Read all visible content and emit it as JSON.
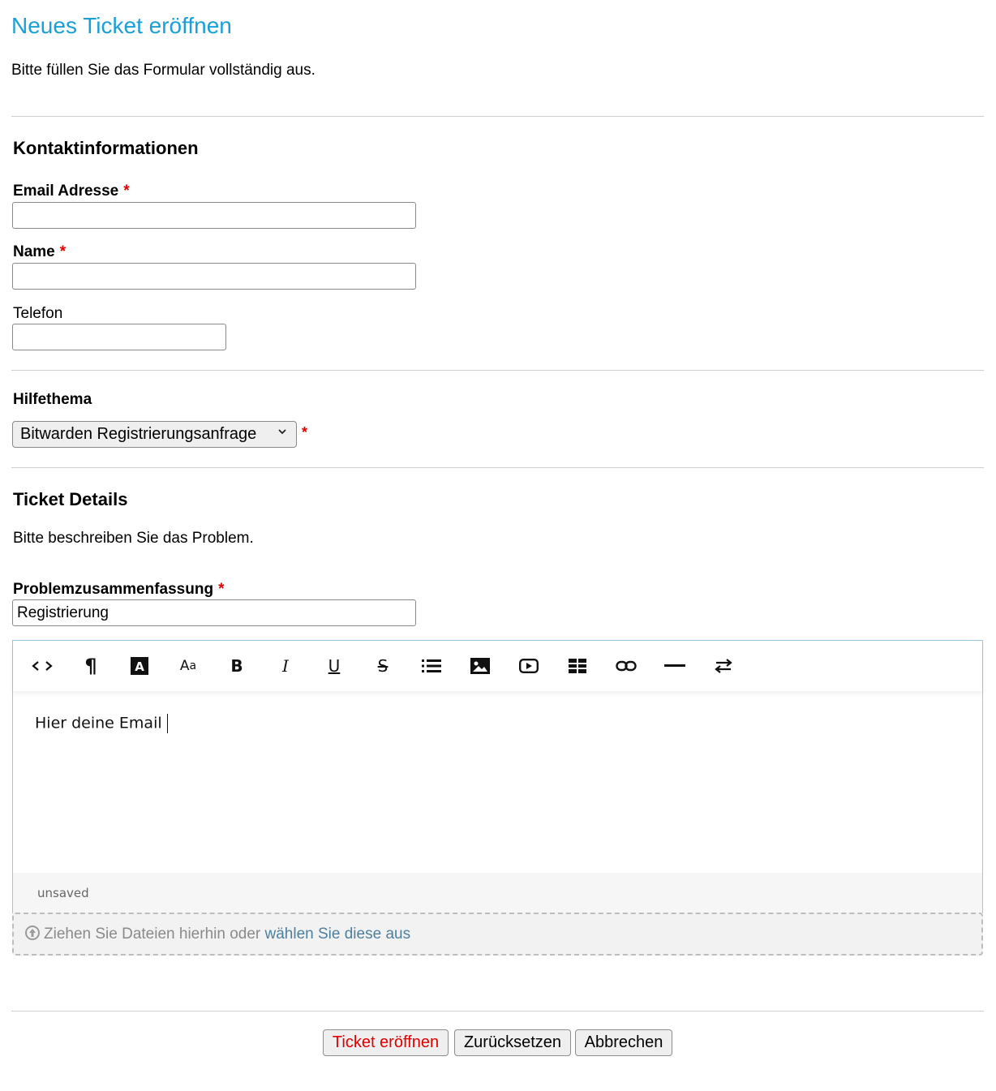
{
  "page": {
    "title": "Neues Ticket eröffnen",
    "intro": "Bitte füllen Sie das Formular vollständig aus."
  },
  "contact": {
    "section_title": "Kontaktinformationen",
    "email_label": "Email Adresse",
    "email_value": "",
    "name_label": "Name",
    "name_value": "",
    "phone_label": "Telefon",
    "phone_value": "",
    "required_mark": "*"
  },
  "topic": {
    "label": "Hilfethema",
    "selected": "Bitwarden Registrierungsanfrage",
    "required_mark": "*"
  },
  "details": {
    "section_title": "Ticket Details",
    "description": "Bitte beschreiben Sie das Problem.",
    "summary_label": "Problemzusammenfassung",
    "summary_value": "Registrierung",
    "required_mark": "*"
  },
  "editor": {
    "toolbar": [
      {
        "name": "html-code-icon",
        "glyph": "<>"
      },
      {
        "name": "paragraph-icon",
        "glyph": "¶"
      },
      {
        "name": "font-color-icon",
        "glyph": "A"
      },
      {
        "name": "font-size-icon",
        "glyph": "Aa"
      },
      {
        "name": "bold-icon",
        "glyph": "B"
      },
      {
        "name": "italic-icon",
        "glyph": "I"
      },
      {
        "name": "underline-icon",
        "glyph": "U"
      },
      {
        "name": "strikethrough-icon",
        "glyph": "S"
      },
      {
        "name": "bullet-list-icon",
        "glyph": "list"
      },
      {
        "name": "image-icon",
        "glyph": "img"
      },
      {
        "name": "video-icon",
        "glyph": "video"
      },
      {
        "name": "table-icon",
        "glyph": "table"
      },
      {
        "name": "link-icon",
        "glyph": "link"
      },
      {
        "name": "horizontal-rule-icon",
        "glyph": "hr"
      },
      {
        "name": "text-direction-icon",
        "glyph": "dir"
      }
    ],
    "content": "Hier deine Email",
    "status": "unsaved"
  },
  "attachments": {
    "prefix": "Ziehen Sie Dateien hierhin oder",
    "link": "wählen Sie diese aus"
  },
  "actions": {
    "submit": "Ticket eröffnen",
    "reset": "Zurücksetzen",
    "cancel": "Abbrechen"
  },
  "colors": {
    "title": "#1b9fd8",
    "required": "#e00000",
    "link": "#4f7f9e",
    "editor_border": "#9cc7dc"
  }
}
